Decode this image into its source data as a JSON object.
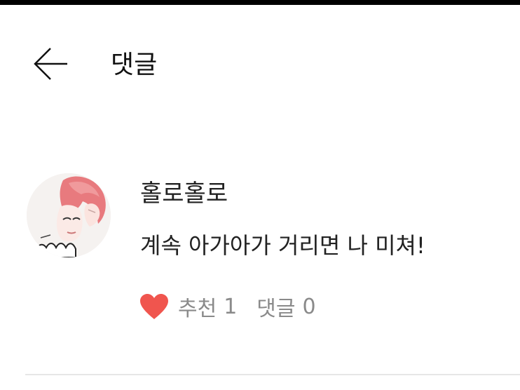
{
  "header": {
    "back_icon": "arrow-left-icon",
    "title": "댓글"
  },
  "comment": {
    "avatar": "avatar",
    "author": "홀로홀로",
    "text": "계속 아가아가 거리면 나 미쳐!",
    "like_icon": "heart-icon",
    "like_color": "#F0554E",
    "like_label": "추천",
    "like_count": "1",
    "reply_label": "댓글",
    "reply_count": "0"
  }
}
